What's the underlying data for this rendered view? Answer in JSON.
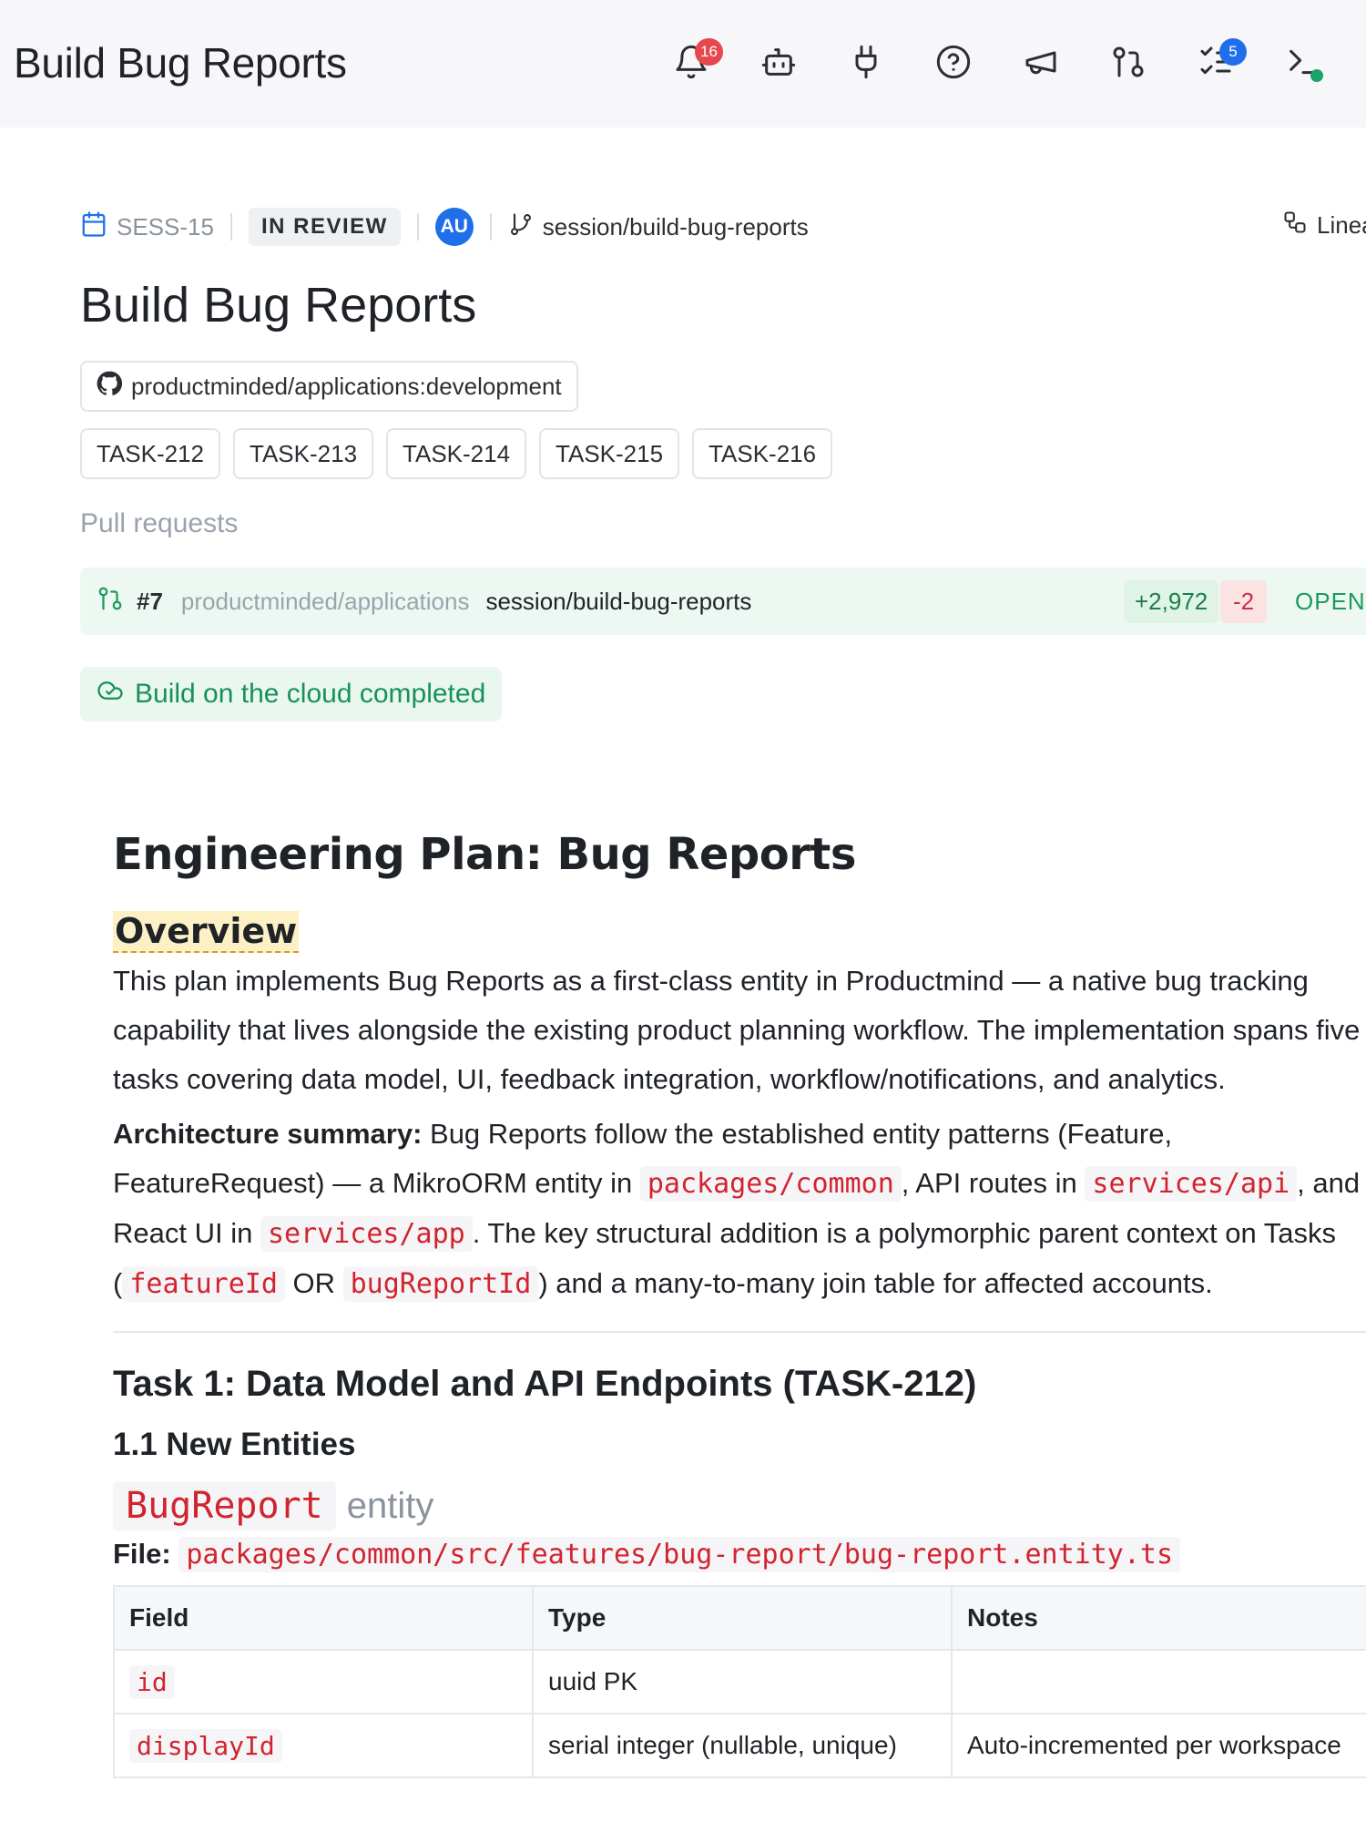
{
  "app": {
    "title": "Build Bug Reports",
    "notifications_count": "16",
    "tasks_count": "5"
  },
  "topbar_icons": [
    "bell-icon",
    "bot-icon",
    "plug-icon",
    "help-icon",
    "megaphone-icon",
    "git-pull-request-icon",
    "checklist-icon",
    "terminal-icon"
  ],
  "session": {
    "id": "SESS-15",
    "status": "IN REVIEW",
    "assignee_initials": "AU",
    "branch": "session/build-bug-reports",
    "linear_label": "Linea",
    "title": "Build Bug Reports",
    "repo": "productminded/applications:development",
    "tasks": [
      "TASK-212",
      "TASK-213",
      "TASK-214",
      "TASK-215",
      "TASK-216"
    ]
  },
  "pull_requests": {
    "label": "Pull requests",
    "items": [
      {
        "number": "#7",
        "repo": "productminded/applications",
        "branch": "session/build-bug-reports",
        "additions": "+2,972",
        "deletions": "-2",
        "state": "OPEN"
      }
    ]
  },
  "build_status": "Build on the cloud completed",
  "doc": {
    "title": "Engineering Plan: Bug Reports",
    "overview_heading": "Overview",
    "overview_text": "This plan implements Bug Reports as a first-class entity in Productmind — a native bug tracking capability that lives alongside the existing product planning workflow. The implementation spans five tasks covering data model, UI, feedback integration, workflow/notifications, and analytics.",
    "arch": {
      "label": "Architecture summary:",
      "t1": " Bug Reports follow the established entity patterns (Feature, FeatureRequest) — a MikroORM entity in ",
      "c1": "packages/common",
      "t2": ", API routes in ",
      "c2": "services/api",
      "t3": ", and React UI in ",
      "c3": "services/app",
      "t4": ". The key structural addition is a polymorphic parent context on Tasks (",
      "c4": "featureId",
      "t5": " OR ",
      "c5": "bugReportId",
      "t6": ") and a many-to-many join table for affected accounts."
    },
    "task1_heading": "Task 1: Data Model and API Endpoints (TASK-212)",
    "section_1_1": "1.1 New Entities",
    "entity_name": "BugReport",
    "entity_suffix": "entity",
    "file_label": "File:",
    "file_path": "packages/common/src/features/bug-report/bug-report.entity.ts",
    "table": {
      "headers": [
        "Field",
        "Type",
        "Notes"
      ],
      "rows": [
        {
          "field": "id",
          "type": "uuid PK",
          "notes": ""
        },
        {
          "field": "displayId",
          "type": "serial integer (nullable, unique)",
          "notes": "Auto-incremented per workspace"
        }
      ]
    }
  }
}
